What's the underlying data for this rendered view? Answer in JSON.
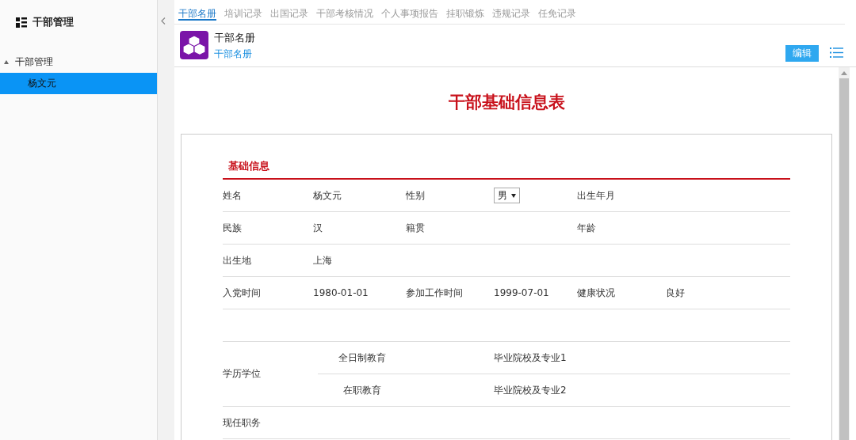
{
  "sidebar": {
    "title": "干部管理",
    "tree": [
      {
        "label": "干部管理",
        "expanded": true,
        "selected": false,
        "children": [
          {
            "label": "杨文元",
            "selected": true
          }
        ]
      }
    ]
  },
  "tabs": [
    {
      "label": "干部名册",
      "selected": true
    },
    {
      "label": "培训记录",
      "selected": false
    },
    {
      "label": "出国记录",
      "selected": false
    },
    {
      "label": "干部考核情况",
      "selected": false
    },
    {
      "label": "个人事项报告",
      "selected": false
    },
    {
      "label": "挂职锻炼",
      "selected": false
    },
    {
      "label": "违规记录",
      "selected": false
    },
    {
      "label": "任免记录",
      "selected": false
    }
  ],
  "header": {
    "title": "干部名册",
    "subtitle": "干部名册",
    "edit_button": "编辑"
  },
  "document": {
    "title": "干部基础信息表",
    "section": "基础信息",
    "rows": [
      {
        "kind": "fields",
        "fields": [
          {
            "label": "姓名",
            "value": "杨文元"
          },
          {
            "label": "性别",
            "value": "男",
            "kind": "select"
          },
          {
            "label": "出生年月"
          }
        ]
      },
      {
        "kind": "fields",
        "fields": [
          {
            "label": "民族",
            "value": "汉"
          },
          {
            "label": "籍贯"
          },
          {
            "label": "年龄"
          }
        ]
      },
      {
        "kind": "fields",
        "fields": [
          {
            "label": "出生地",
            "value": "上海"
          }
        ]
      },
      {
        "kind": "fields",
        "fields": [
          {
            "label": "入党时间",
            "value": "1980-01-01"
          },
          {
            "label": "参加工作时间",
            "value": "1999-07-01"
          },
          {
            "label": "健康状况",
            "value": "良好"
          }
        ]
      },
      {
        "kind": "blank"
      },
      {
        "kind": "education",
        "label": "学历学位",
        "entries": [
          {
            "type": "全日制教育",
            "school": "毕业院校及专业1"
          },
          {
            "type": "在职教育",
            "school": "毕业院校及专业2"
          }
        ]
      },
      {
        "kind": "fields",
        "fields": [
          {
            "label": "现任职务"
          }
        ]
      }
    ]
  }
}
